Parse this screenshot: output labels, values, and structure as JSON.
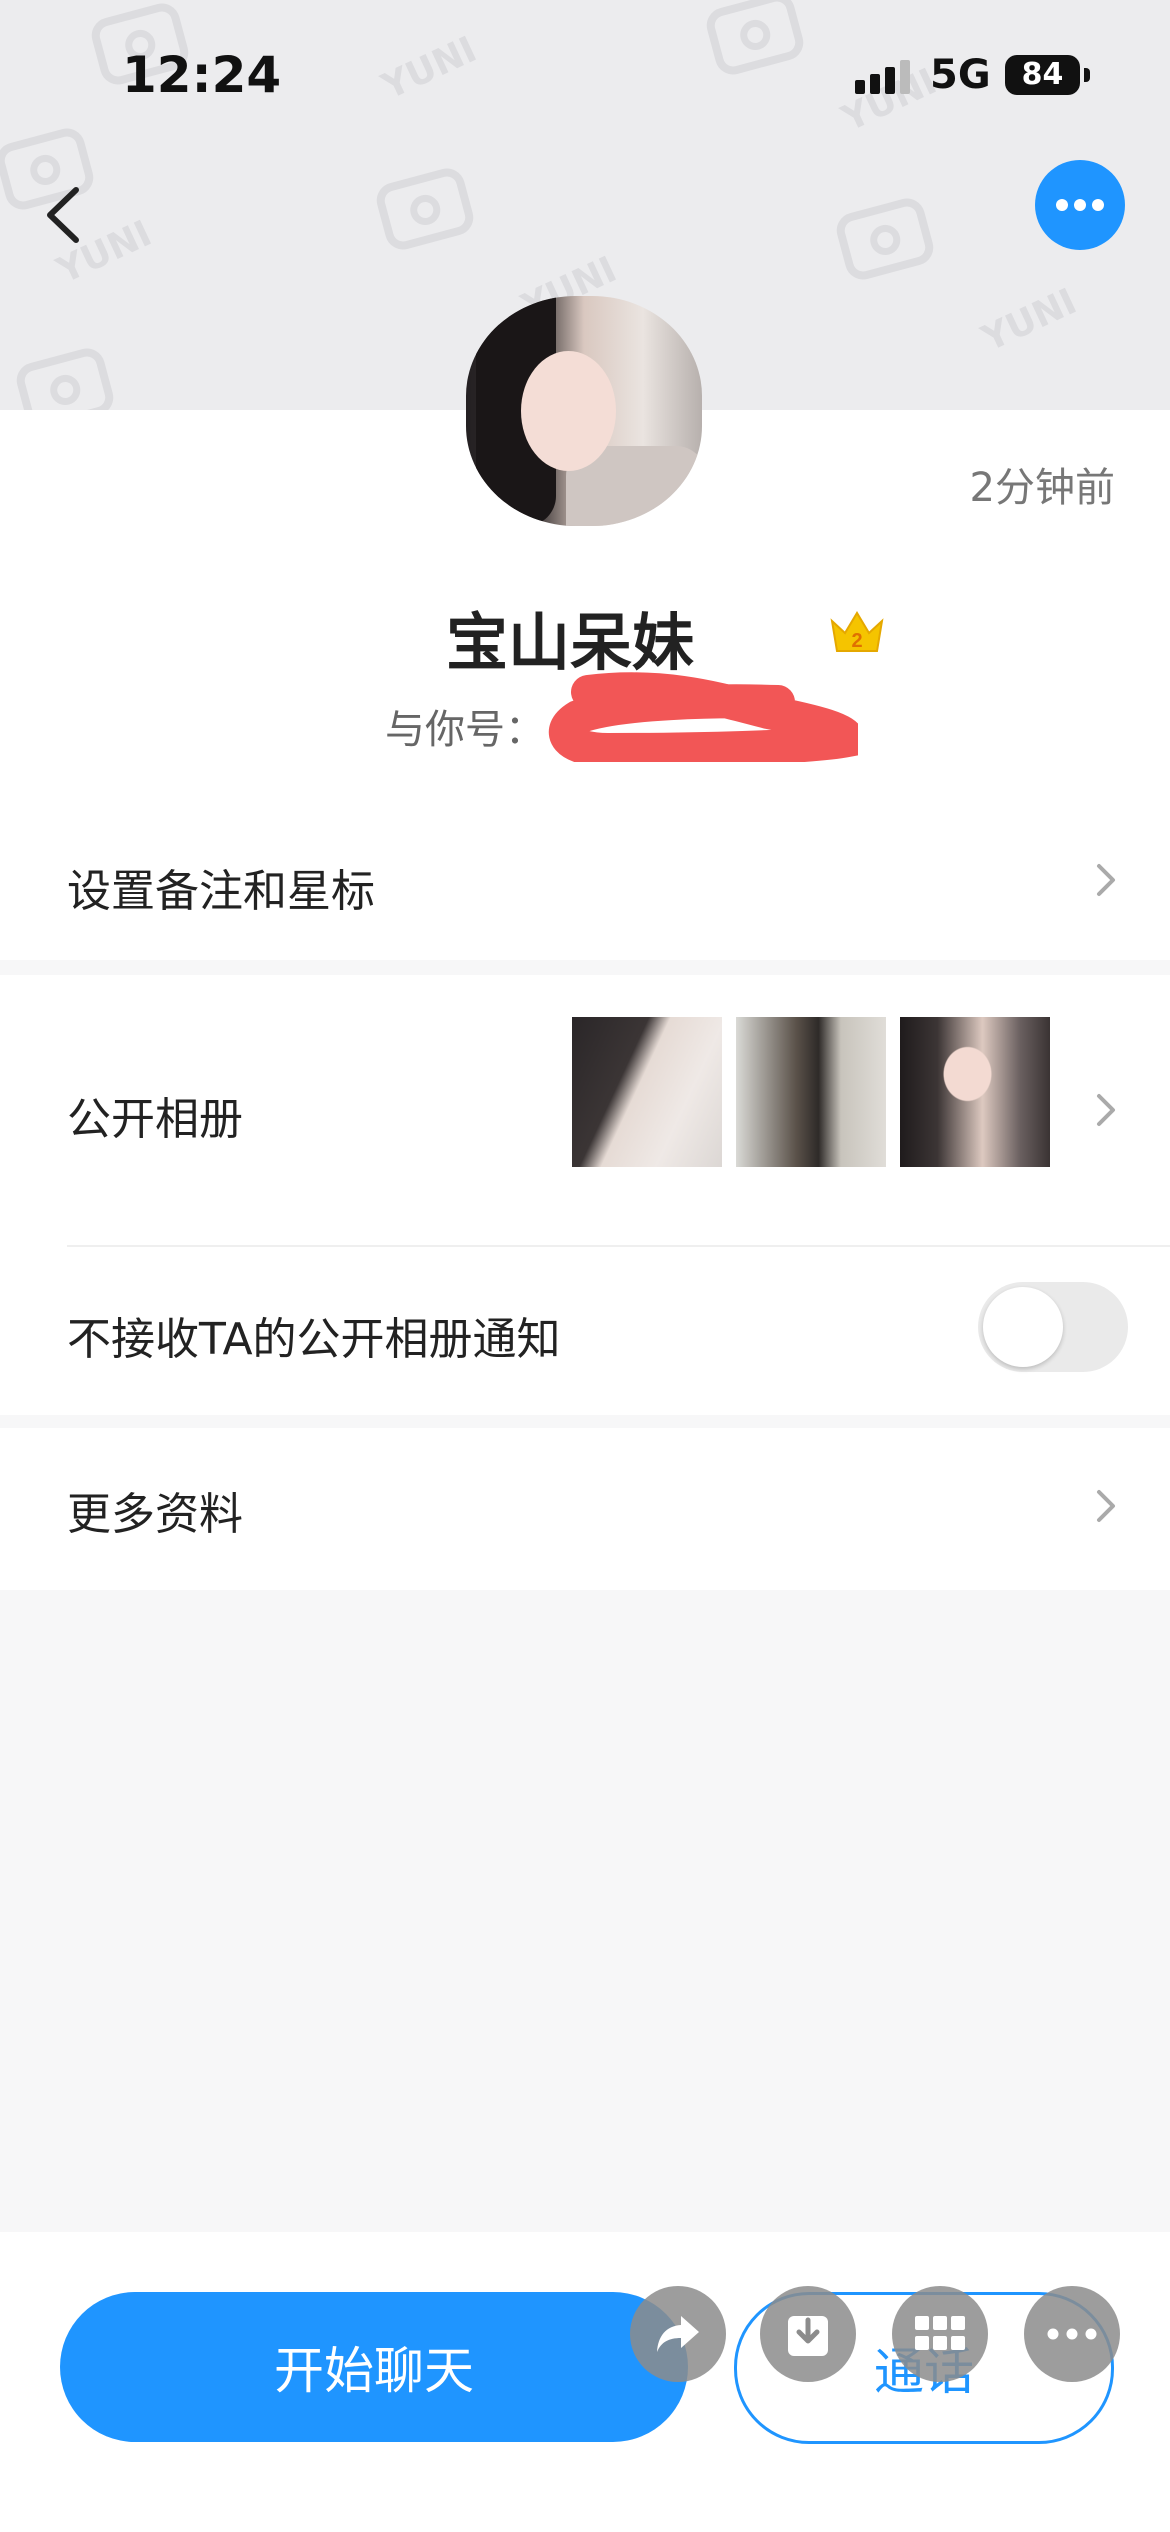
{
  "status_bar": {
    "time": "12:24",
    "network": "5G",
    "battery": "84"
  },
  "header": {
    "watermark_text": "YUNI"
  },
  "profile": {
    "last_seen": "2分钟前",
    "name": "宝山呆妹",
    "crown_level": "2",
    "account_label": "与你号："
  },
  "rows": {
    "remark": {
      "label": "设置备注和星标"
    },
    "album": {
      "label": "公开相册"
    },
    "album_notify": {
      "label": "不接收TA的公开相册通知",
      "enabled": false
    },
    "more_info": {
      "label": "更多资料"
    }
  },
  "bottom": {
    "chat_label": "开始聊天",
    "call_label": "通话"
  },
  "colors": {
    "accent": "#1f95ff",
    "crown": "#f5c400",
    "redaction": "#f25656"
  }
}
